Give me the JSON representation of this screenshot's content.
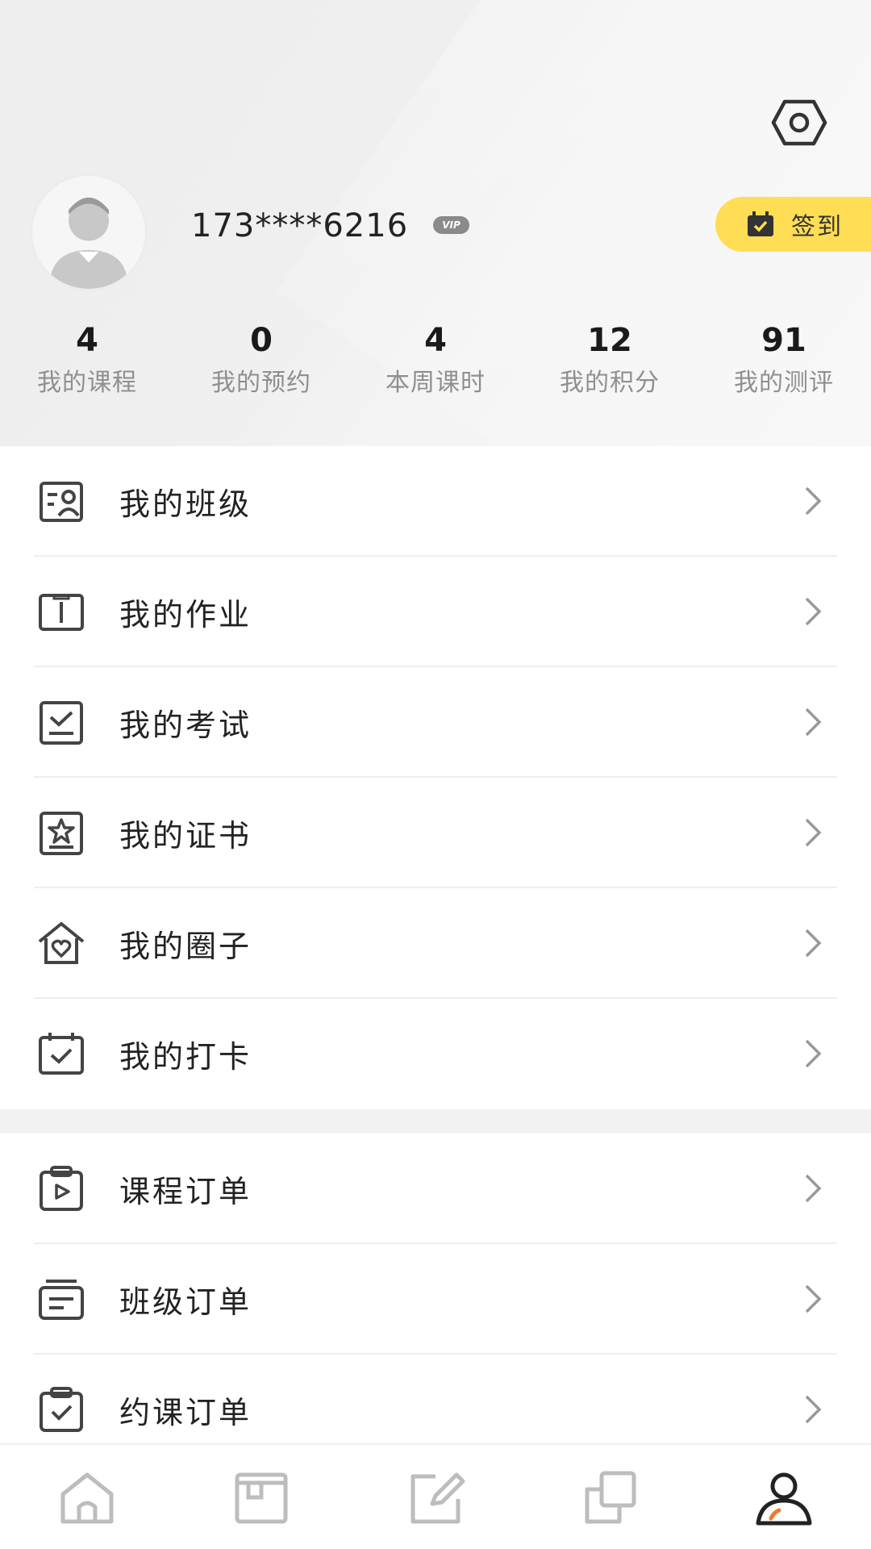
{
  "profile": {
    "phone": "173****6216",
    "vip_label": "VIP",
    "checkin_label": "签到"
  },
  "stats": [
    {
      "value": "4",
      "label": "我的课程"
    },
    {
      "value": "0",
      "label": "我的预约"
    },
    {
      "value": "4",
      "label": "本周课时"
    },
    {
      "value": "12",
      "label": "我的积分"
    },
    {
      "value": "91",
      "label": "我的测评"
    }
  ],
  "menu_primary": [
    {
      "label": "我的班级",
      "icon": "class-icon"
    },
    {
      "label": "我的作业",
      "icon": "book-icon"
    },
    {
      "label": "我的考试",
      "icon": "exam-icon"
    },
    {
      "label": "我的证书",
      "icon": "certificate-icon"
    },
    {
      "label": "我的圈子",
      "icon": "community-icon"
    },
    {
      "label": "我的打卡",
      "icon": "calendar-check-icon"
    }
  ],
  "menu_orders": [
    {
      "label": "课程订单",
      "icon": "course-order-icon"
    },
    {
      "label": "班级订单",
      "icon": "class-order-icon"
    },
    {
      "label": "约课订单",
      "icon": "booking-order-icon"
    }
  ],
  "tabbar": {
    "items": [
      "home-icon",
      "browse-icon",
      "edit-icon",
      "copy-icon",
      "profile-icon"
    ],
    "active_index": 4
  },
  "colors": {
    "accent_yellow": "#ffdd55",
    "active_tab_accent": "#f07a2a",
    "icon_gray": "#444444",
    "inactive_tab": "#bdbdbd"
  }
}
